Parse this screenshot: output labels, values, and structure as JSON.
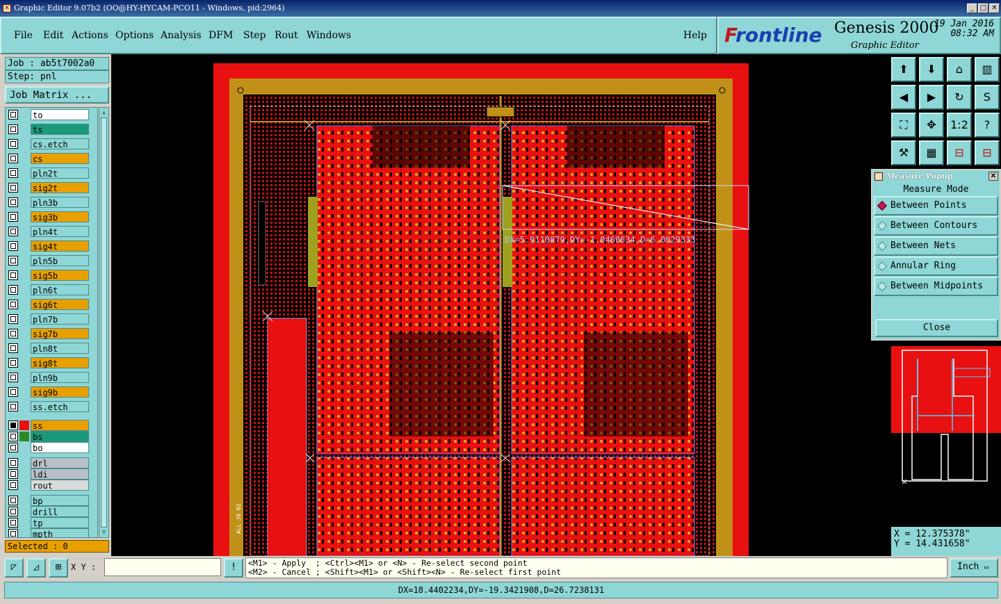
{
  "window": {
    "title": "Graphic Editor 9.07b2 (OO@HY-HYCAM-PCO11 - Windows, pid:2964)",
    "min": "_",
    "max": "□",
    "close": "✕"
  },
  "menu": {
    "items": [
      "File",
      "Edit",
      "Actions",
      "Options",
      "Analysis",
      "DFM",
      "Step",
      "Rout",
      "Windows"
    ],
    "help": "Help"
  },
  "brand": {
    "logo_prefix": "F",
    "logo_rest": "rontline",
    "product": "Genesis 2000",
    "subtitle": "Graphic Editor",
    "date": "19 Jan 2016",
    "time": "08:32 AM"
  },
  "left": {
    "job": "Job : ab5t7002a0",
    "step": "Step: pnl",
    "job_matrix": "Job Matrix ...",
    "selected": "Selected : 0"
  },
  "layers": [
    {
      "name": "to",
      "color": "#ffffff",
      "swatch": "#8fd6d6"
    },
    {
      "name": "ts",
      "color": "#1a9a7a",
      "swatch": "#8fd6d6"
    },
    {
      "name": "cs.etch",
      "color": "#8fd6d6",
      "swatch": "#8fd6d6"
    },
    {
      "name": "cs",
      "color": "#e8a000",
      "swatch": "#8fd6d6"
    },
    {
      "name": "pln2t",
      "color": "#8fd6d6",
      "swatch": "#8fd6d6"
    },
    {
      "name": "sig2t",
      "color": "#e8a000",
      "swatch": "#8fd6d6"
    },
    {
      "name": "pln3b",
      "color": "#8fd6d6",
      "swatch": "#8fd6d6"
    },
    {
      "name": "sig3b",
      "color": "#e8a000",
      "swatch": "#8fd6d6"
    },
    {
      "name": "pln4t",
      "color": "#8fd6d6",
      "swatch": "#8fd6d6"
    },
    {
      "name": "sig4t",
      "color": "#e8a000",
      "swatch": "#8fd6d6"
    },
    {
      "name": "pln5b",
      "color": "#8fd6d6",
      "swatch": "#8fd6d6"
    },
    {
      "name": "sig5b",
      "color": "#e8a000",
      "swatch": "#8fd6d6"
    },
    {
      "name": "pln6t",
      "color": "#8fd6d6",
      "swatch": "#8fd6d6"
    },
    {
      "name": "sig6t",
      "color": "#e8a000",
      "swatch": "#8fd6d6"
    },
    {
      "name": "pln7b",
      "color": "#8fd6d6",
      "swatch": "#8fd6d6"
    },
    {
      "name": "sig7b",
      "color": "#e8a000",
      "swatch": "#8fd6d6"
    },
    {
      "name": "pln8t",
      "color": "#8fd6d6",
      "swatch": "#8fd6d6"
    },
    {
      "name": "sig8t",
      "color": "#e8a000",
      "swatch": "#8fd6d6"
    },
    {
      "name": "pln9b",
      "color": "#8fd6d6",
      "swatch": "#8fd6d6"
    },
    {
      "name": "sig9b",
      "color": "#e8a000",
      "swatch": "#8fd6d6"
    },
    {
      "name": "ss.etch",
      "color": "#8fd6d6",
      "swatch": "#8fd6d6"
    },
    {
      "name": "ss",
      "color": "#e8a000",
      "swatch": "#e81010"
    },
    {
      "name": "bs",
      "color": "#1a9a7a",
      "swatch": "#2a8a2a"
    },
    {
      "name": "bo",
      "color": "#ffffff",
      "swatch": "#8fd6d6"
    },
    {
      "name": "drl",
      "color": "#b8c0c8",
      "swatch": "#8fd6d6"
    },
    {
      "name": "ldi",
      "color": "#b8c0c8",
      "swatch": "#8fd6d6"
    },
    {
      "name": "rout",
      "color": "#d8dcdc",
      "swatch": "#8fd6d6"
    },
    {
      "name": "bp",
      "color": "#8fd6d6",
      "swatch": "#8fd6d6"
    },
    {
      "name": "drill",
      "color": "#8fd6d6",
      "swatch": "#8fd6d6"
    },
    {
      "name": "tp",
      "color": "#8fd6d6",
      "swatch": "#8fd6d6"
    },
    {
      "name": "mpth",
      "color": "#8fd6d6",
      "swatch": "#8fd6d6"
    }
  ],
  "canvas": {
    "measure_text": "DX=5.9110879,DY=-1.0460634,D=6.0029333",
    "board_label": "ALL J0 02"
  },
  "toolbar": {
    "icons": [
      "zoom-home-icon",
      "zoom-back-icon",
      "home-icon",
      "panels-icon",
      "pan-left-icon",
      "pan-right-icon",
      "redo-icon",
      "snap-icon",
      "fit-icon",
      "center-icon",
      "ratio-icon",
      "help-icon",
      "tools-icon",
      "grid-icon",
      "layers-red-icon",
      "layers-red2-icon"
    ],
    "ratio_label": "1:2"
  },
  "popup": {
    "title": "Measure Popup",
    "mode": "Measure Mode",
    "options": [
      {
        "label": "Between Points",
        "selected": true
      },
      {
        "label": "Between Contours",
        "selected": false
      },
      {
        "label": "Between Nets",
        "selected": false
      },
      {
        "label": "Annular Ring",
        "selected": false
      },
      {
        "label": "Between Midpoints",
        "selected": false
      }
    ],
    "close": "Close"
  },
  "coords": {
    "x": "X = 12.375378\"",
    "y": "Y = 14.431658\""
  },
  "bottom": {
    "xy_label": "X Y :",
    "xy_value": "",
    "hint1": "<M1> - Apply  ; <Ctrl><M1> or <N> - Re-select second point",
    "hint2": "<M2> - Cancel ; <Shift><M1> or <Shift><N> - Re-select first point",
    "unit": "Inch"
  },
  "status": "DX=18.4402234,DY=-19.3421908,D=26.7238131"
}
